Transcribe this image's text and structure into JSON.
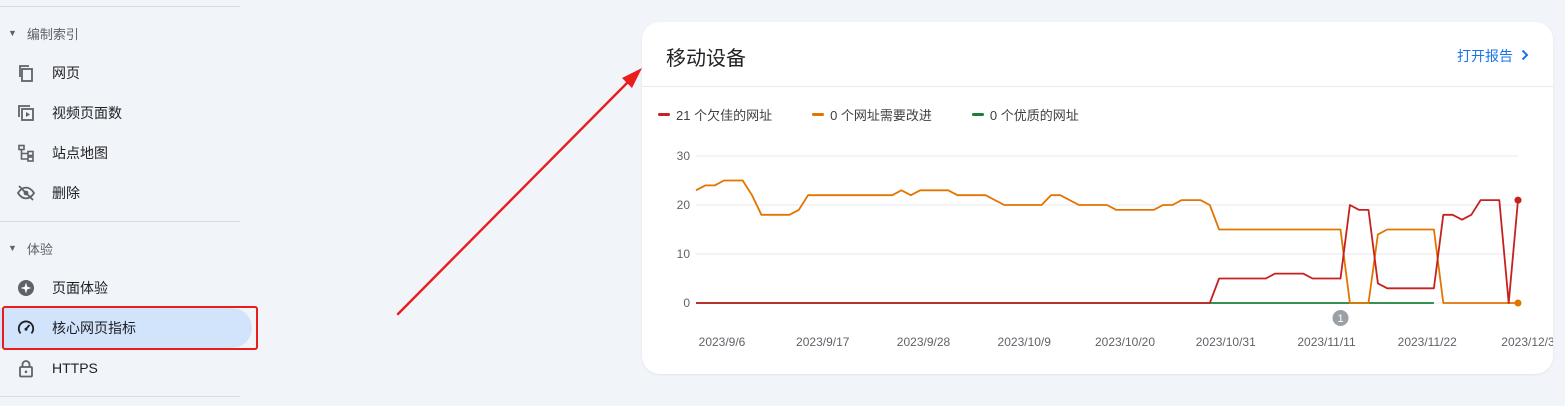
{
  "sidebar": {
    "sections": [
      {
        "label": "编制索引",
        "items": [
          {
            "label": "网页",
            "icon": "pages-icon"
          },
          {
            "label": "视频页面数",
            "icon": "video-pages-icon"
          },
          {
            "label": "站点地图",
            "icon": "sitemap-icon"
          },
          {
            "label": "删除",
            "icon": "removals-icon"
          }
        ]
      },
      {
        "label": "体验",
        "items": [
          {
            "label": "页面体验",
            "icon": "page-experience-icon"
          },
          {
            "label": "核心网页指标",
            "icon": "core-web-vitals-icon",
            "selected": true
          },
          {
            "label": "HTTPS",
            "icon": "lock-icon"
          }
        ]
      }
    ]
  },
  "card": {
    "title": "移动设备",
    "open_report": "打开报告"
  },
  "colors": {
    "poor": "#c5221f",
    "needs_improvement": "#e37400",
    "good": "#188038",
    "accent": "#1a73e8",
    "annotation_red": "#ea1c1c"
  },
  "chart_data": {
    "type": "line",
    "legend": [
      "21 个欠佳的网址",
      "0 个网址需要改进",
      "0 个优质的网址"
    ],
    "x_tick_labels": [
      "2023/9/6",
      "2023/9/17",
      "2023/9/28",
      "2023/10/9",
      "2023/10/20",
      "2023/10/31",
      "2023/11/11",
      "2023/11/22",
      "2023/12/3"
    ],
    "y_ticks": [
      0,
      10,
      20,
      30
    ],
    "ylim": [
      0,
      30
    ],
    "x_start": "2023/9/6",
    "x_end": "2023/12/3",
    "annotation": {
      "label": "1",
      "date": "2023/11/14"
    },
    "series": [
      {
        "name": "21 个欠佳的网址",
        "color": "#c5221f",
        "points": [
          [
            "2023/9/6",
            0
          ],
          [
            "2023/10/31",
            0
          ],
          [
            "2023/11/1",
            5
          ],
          [
            "2023/11/6",
            5
          ],
          [
            "2023/11/7",
            6
          ],
          [
            "2023/11/10",
            6
          ],
          [
            "2023/11/11",
            5
          ],
          [
            "2023/11/14",
            5
          ],
          [
            "2023/11/15",
            20
          ],
          [
            "2023/11/16",
            19
          ],
          [
            "2023/11/17",
            19
          ],
          [
            "2023/11/18",
            4
          ],
          [
            "2023/11/19",
            3
          ],
          [
            "2023/11/24",
            3
          ],
          [
            "2023/11/25",
            18
          ],
          [
            "2023/11/26",
            18
          ],
          [
            "2023/11/27",
            17
          ],
          [
            "2023/11/28",
            18
          ],
          [
            "2023/11/29",
            21
          ],
          [
            "2023/12/1",
            21
          ],
          [
            "2023/12/2",
            0
          ],
          [
            "2023/12/3",
            21
          ]
        ]
      },
      {
        "name": "0 个网址需要改进",
        "color": "#e37400",
        "points": [
          [
            "2023/9/6",
            23
          ],
          [
            "2023/9/7",
            24
          ],
          [
            "2023/9/8",
            24
          ],
          [
            "2023/9/9",
            25
          ],
          [
            "2023/9/11",
            25
          ],
          [
            "2023/9/12",
            22
          ],
          [
            "2023/9/13",
            18
          ],
          [
            "2023/9/16",
            18
          ],
          [
            "2023/9/17",
            19
          ],
          [
            "2023/9/18",
            22
          ],
          [
            "2023/9/27",
            22
          ],
          [
            "2023/9/28",
            23
          ],
          [
            "2023/9/29",
            22
          ],
          [
            "2023/9/30",
            23
          ],
          [
            "2023/10/3",
            23
          ],
          [
            "2023/10/4",
            22
          ],
          [
            "2023/10/7",
            22
          ],
          [
            "2023/10/9",
            20
          ],
          [
            "2023/10/13",
            20
          ],
          [
            "2023/10/14",
            22
          ],
          [
            "2023/10/15",
            22
          ],
          [
            "2023/10/17",
            20
          ],
          [
            "2023/10/20",
            20
          ],
          [
            "2023/10/21",
            19
          ],
          [
            "2023/10/25",
            19
          ],
          [
            "2023/10/26",
            20
          ],
          [
            "2023/10/27",
            20
          ],
          [
            "2023/10/28",
            21
          ],
          [
            "2023/10/30",
            21
          ],
          [
            "2023/10/31",
            20
          ],
          [
            "2023/11/1",
            15
          ],
          [
            "2023/11/14",
            15
          ],
          [
            "2023/11/15",
            0
          ],
          [
            "2023/11/17",
            0
          ],
          [
            "2023/11/18",
            14
          ],
          [
            "2023/11/19",
            15
          ],
          [
            "2023/11/24",
            15
          ],
          [
            "2023/11/25",
            0
          ],
          [
            "2023/12/3",
            0
          ]
        ]
      },
      {
        "name": "0 个优质的网址",
        "color": "#188038",
        "points": [
          [
            "2023/9/6",
            0
          ],
          [
            "2023/10/31",
            0
          ],
          [
            "2023/11/24",
            0
          ]
        ]
      }
    ]
  }
}
